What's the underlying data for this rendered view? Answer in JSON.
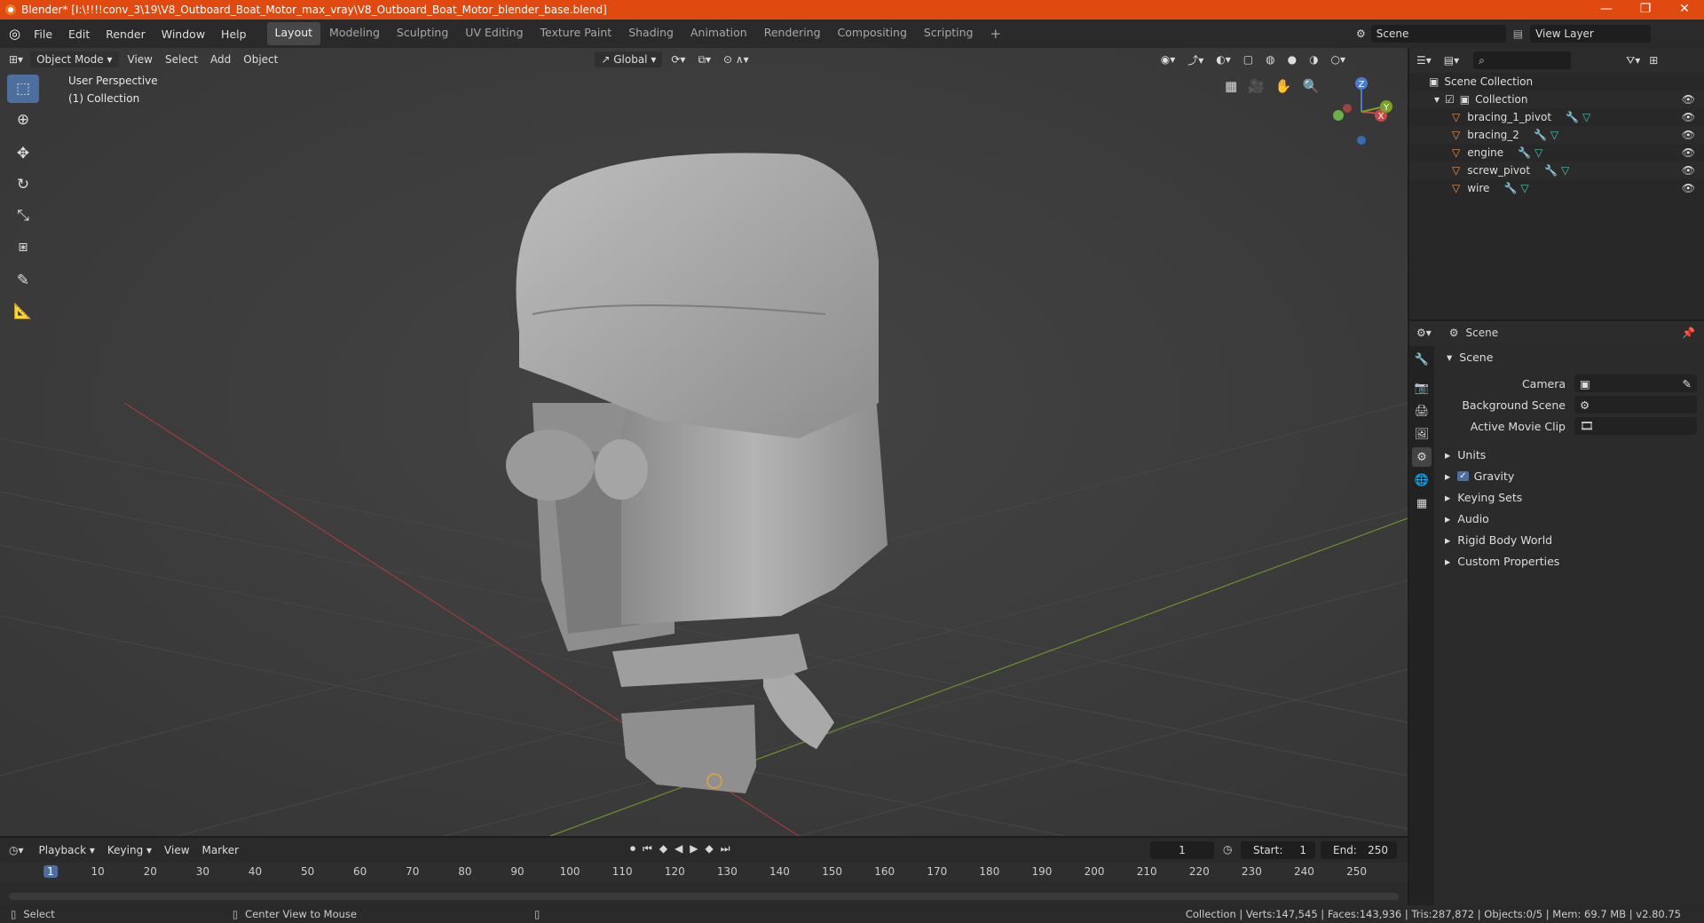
{
  "window": {
    "title": "Blender* [I:\\!!!!conv_3\\19\\V8_Outboard_Boat_Motor_max_vray\\V8_Outboard_Boat_Motor_blender_base.blend]",
    "minimize": "—",
    "restore": "❐",
    "close": "✕"
  },
  "menu": [
    "File",
    "Edit",
    "Render",
    "Window",
    "Help"
  ],
  "workspaces": [
    "Layout",
    "Modeling",
    "Sculpting",
    "UV Editing",
    "Texture Paint",
    "Shading",
    "Animation",
    "Rendering",
    "Compositing",
    "Scripting"
  ],
  "active_workspace": "Layout",
  "scene_selector": "Scene",
  "view_layer": "View Layer",
  "viewport": {
    "mode": "Object Mode",
    "menus": [
      "View",
      "Select",
      "Add",
      "Object"
    ],
    "orientation": "Global",
    "overlay_title": "User Perspective",
    "overlay_collection": "(1) Collection",
    "gizmo": {
      "x": "X",
      "y": "Y",
      "z": "Z"
    }
  },
  "outliner": {
    "root": "Scene Collection",
    "collection": "Collection",
    "items": [
      "bracing_1_pivot",
      "bracing_2",
      "engine",
      "screw_pivot",
      "wire"
    ]
  },
  "properties": {
    "header": "Scene",
    "section": "Scene",
    "camera_label": "Camera",
    "background_label": "Background Scene",
    "movieclip_label": "Active Movie Clip",
    "panels": [
      "Units",
      "Gravity",
      "Keying Sets",
      "Audio",
      "Rigid Body World",
      "Custom Properties"
    ]
  },
  "timeline": {
    "menus": [
      "Playback",
      "Keying",
      "View",
      "Marker"
    ],
    "current_frame": "1",
    "start_label": "Start:",
    "start": "1",
    "end_label": "End:",
    "end": "250",
    "ticks": [
      "1",
      "10",
      "20",
      "30",
      "40",
      "50",
      "60",
      "70",
      "80",
      "90",
      "100",
      "110",
      "120",
      "130",
      "140",
      "150",
      "160",
      "170",
      "180",
      "190",
      "200",
      "210",
      "220",
      "230",
      "240",
      "250"
    ]
  },
  "status": {
    "select": "Select",
    "center": "Center View to Mouse",
    "stats": "Collection | Verts:147,545 | Faces:143,936 | Tris:287,872 | Objects:0/5 | Mem: 69.7 MB | v2.80.75"
  },
  "colors": {
    "titlebar": "#e04a10",
    "accent": "#4d6fa0",
    "x_axis": "#c44a4a",
    "y_axis": "#7aa02a"
  }
}
